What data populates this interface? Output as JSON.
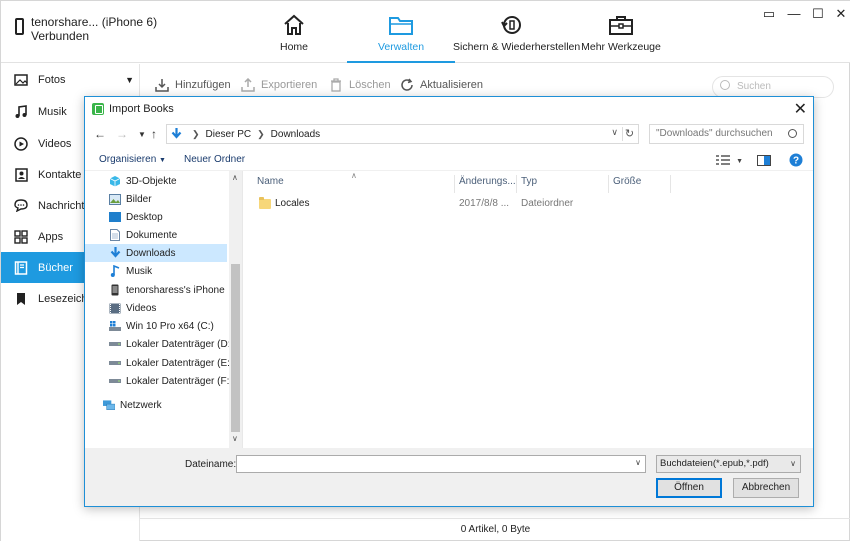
{
  "device": {
    "name": "tenorshare... (iPhone 6)",
    "status": "Verbunden"
  },
  "nav_tabs": [
    {
      "label": "Home",
      "icon": "home-icon",
      "active": false
    },
    {
      "label": "Verwalten",
      "icon": "folder-icon",
      "active": true
    },
    {
      "label": "Sichern & Wiederherstellen",
      "icon": "backup-restore-icon",
      "active": false
    },
    {
      "label": "Mehr Werkzeuge",
      "icon": "toolbox-icon",
      "active": false
    }
  ],
  "window_controls": {
    "restore": "▭",
    "minimize": "—",
    "maximize": "☐",
    "close": "✕"
  },
  "sidebar": {
    "items": [
      {
        "label": "Fotos",
        "icon": "photos-icon"
      },
      {
        "label": "Musik",
        "icon": "music-icon"
      },
      {
        "label": "Videos",
        "icon": "video-icon"
      },
      {
        "label": "Kontakte",
        "icon": "contacts-icon"
      },
      {
        "label": "Nachrichten",
        "icon": "messages-icon"
      },
      {
        "label": "Apps",
        "icon": "apps-icon"
      },
      {
        "label": "Bücher",
        "icon": "books-icon",
        "active": true
      },
      {
        "label": "Lesezeichen",
        "icon": "bookmark-icon"
      }
    ]
  },
  "toolbar": {
    "add": "Hinzufügen",
    "export": "Exportieren",
    "delete": "Löschen",
    "refresh": "Aktualisieren",
    "search_placeholder": "Suchen"
  },
  "footer": {
    "status": "0 Artikel, 0 Byte"
  },
  "dialog": {
    "title": "Import Books",
    "close": "✕",
    "address": {
      "root": "Dieser PC",
      "folder": "Downloads"
    },
    "search_placeholder": "\"Downloads\" durchsuchen",
    "commands": {
      "organize": "Organisieren",
      "new_folder": "Neuer Ordner"
    },
    "nav_items": [
      {
        "label": "3D-Objekte",
        "icon": "3d-objects-icon"
      },
      {
        "label": "Bilder",
        "icon": "pictures-icon"
      },
      {
        "label": "Desktop",
        "icon": "desktop-icon"
      },
      {
        "label": "Dokumente",
        "icon": "documents-icon"
      },
      {
        "label": "Downloads",
        "icon": "downloads-icon",
        "selected": true
      },
      {
        "label": "Musik",
        "icon": "music-icon"
      },
      {
        "label": "tenorsharess's iPhone",
        "icon": "iphone-icon"
      },
      {
        "label": "Videos",
        "icon": "videos-icon"
      },
      {
        "label": "Win 10 Pro x64 (C:)",
        "icon": "system-drive-icon"
      },
      {
        "label": "Lokaler Datenträger (D:)",
        "icon": "drive-icon"
      },
      {
        "label": "Lokaler Datenträger (E:)",
        "icon": "drive-icon"
      },
      {
        "label": "Lokaler Datenträger (F:)",
        "icon": "drive-icon"
      },
      {
        "label": "Netzwerk",
        "icon": "network-icon"
      }
    ],
    "columns": [
      "Name",
      "Änderungs...",
      "Typ",
      "Größe"
    ],
    "files": [
      {
        "name": "Locales",
        "date": "2017/8/8 ...",
        "type": "Dateiordner",
        "size": ""
      }
    ],
    "filename_label": "Dateiname:",
    "filename_value": "",
    "filetype": "Buchdateien(*.epub,*.pdf)",
    "open_button": "Öffnen",
    "cancel_button": "Abbrechen"
  }
}
